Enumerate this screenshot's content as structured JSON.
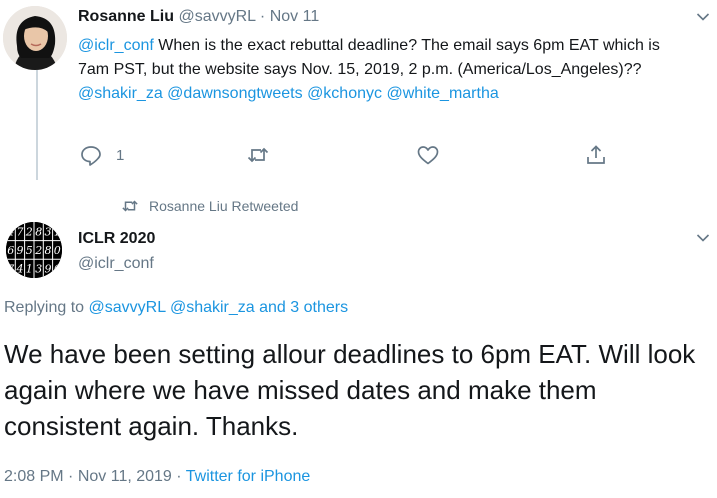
{
  "parent_tweet": {
    "display_name": "Rosanne Liu",
    "handle": "@savvyRL",
    "separator": "·",
    "date": "Nov 11",
    "text_parts": [
      {
        "text": "@iclr_conf",
        "link": true
      },
      {
        "text": " When is the exact rebuttal deadline? The email says 6pm EAT which is 7am PST, but the website says Nov. 15, 2019, 2 p.m. (America/Los_Angeles)?? ",
        "link": false
      },
      {
        "text": "@shakir_za",
        "link": true
      },
      {
        "text": " ",
        "link": false
      },
      {
        "text": "@dawnsongtweets",
        "link": true
      },
      {
        "text": " ",
        "link": false
      },
      {
        "text": "@kchonyc",
        "link": true
      },
      {
        "text": " ",
        "link": false
      },
      {
        "text": "@white_martha",
        "link": true
      }
    ],
    "reply_count": "1",
    "icons": {
      "reply": "reply-icon",
      "retweet": "retweet-icon",
      "like": "heart-icon",
      "share": "share-icon",
      "menu": "chevron-down-icon"
    }
  },
  "retweet_context": {
    "label": "Rosanne Liu Retweeted",
    "icon": "retweet-icon"
  },
  "main_tweet": {
    "display_name": "ICLR 2020",
    "handle": "@iclr_conf",
    "replying_prefix": "Replying to",
    "replying_users": [
      "@savvyRL",
      "@shakir_za"
    ],
    "replying_others": "and 3 others",
    "text": "We have been setting allour deadlines to 6pm EAT. Will look again where we have missed dates and make them consistent again. Thanks.",
    "time": "2:08 PM",
    "separator": "·",
    "date": "Nov 11, 2019",
    "source": "Twitter for iPhone",
    "avatar_digits": [
      "4",
      "7",
      "2",
      "8",
      "3",
      "1",
      "6",
      "9",
      "5",
      "2",
      "8",
      "0",
      "7",
      "4",
      "1",
      "3",
      "9",
      "6"
    ]
  },
  "colors": {
    "link": "#1b95e0",
    "muted": "#657786",
    "text": "#14171a",
    "thread_line": "#ccd6dd"
  }
}
